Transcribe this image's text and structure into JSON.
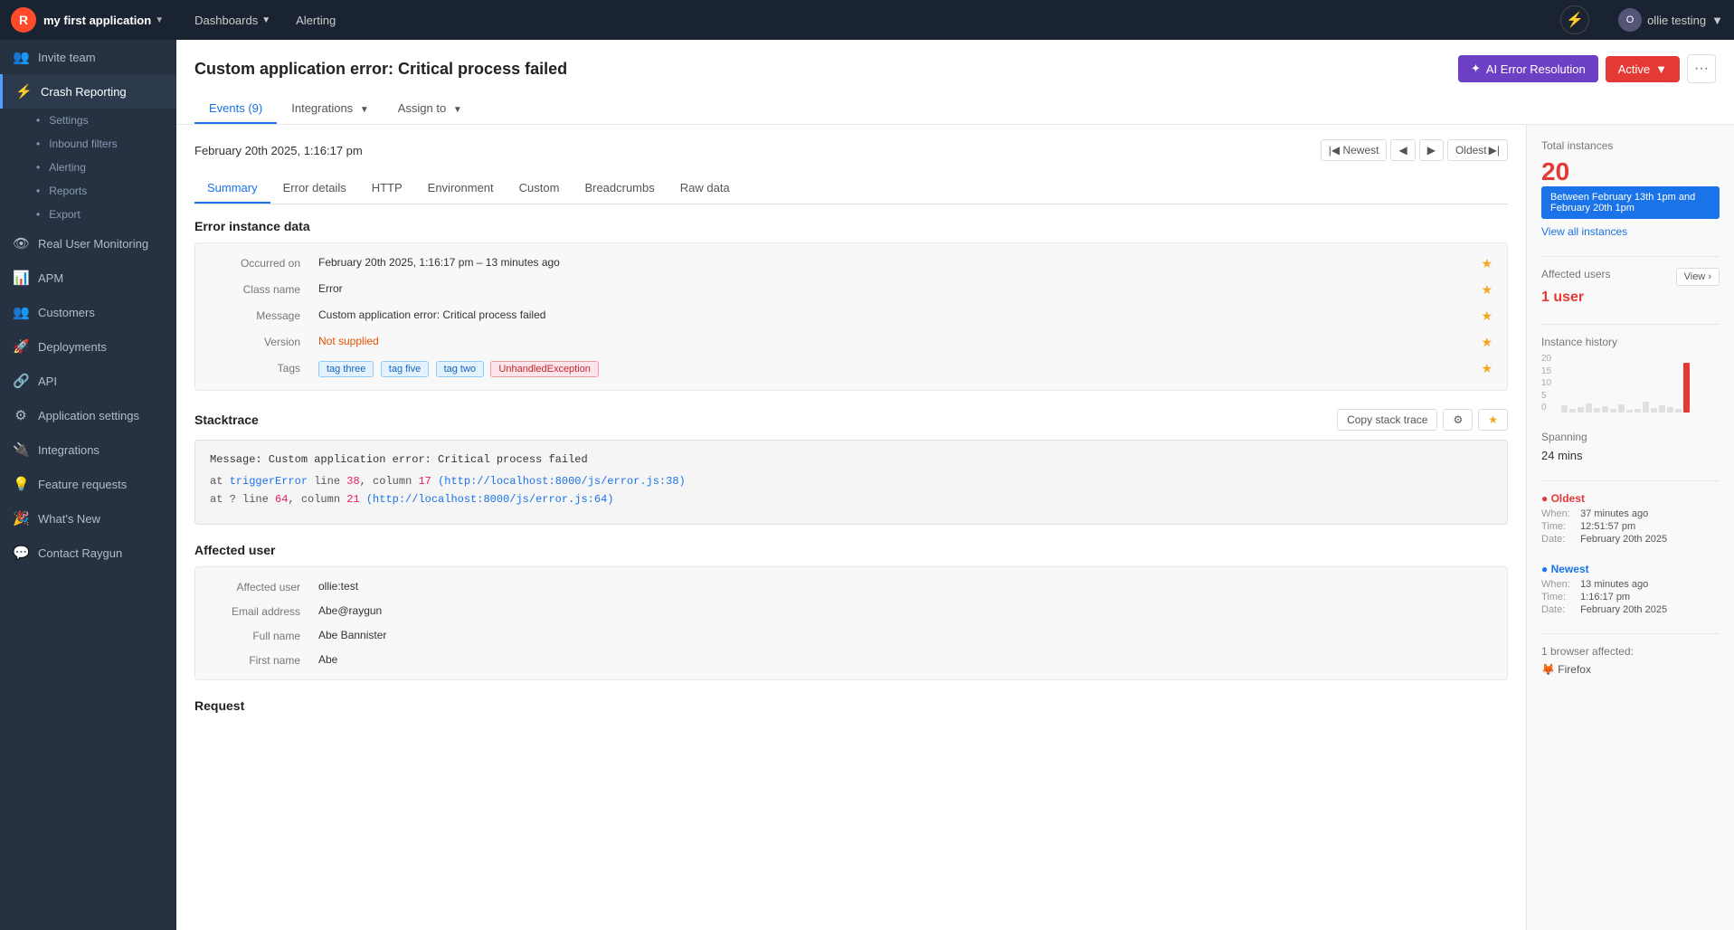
{
  "topnav": {
    "logo": "R",
    "app_name": "my first application",
    "nav_links": [
      {
        "label": "Dashboards",
        "has_dropdown": true
      },
      {
        "label": "Alerting",
        "has_dropdown": false
      }
    ],
    "user": "ollie testing"
  },
  "sidebar": {
    "invite_team": "Invite team",
    "main_items": [
      {
        "id": "crash-reporting",
        "label": "Crash Reporting",
        "icon": "⚡",
        "active": true
      },
      {
        "id": "rum",
        "label": "Real User Monitoring",
        "icon": "👁"
      },
      {
        "id": "apm",
        "label": "APM",
        "icon": "📊"
      },
      {
        "id": "customers",
        "label": "Customers",
        "icon": "👥"
      },
      {
        "id": "deployments",
        "label": "Deployments",
        "icon": "🚀"
      },
      {
        "id": "api",
        "label": "API",
        "icon": "🔗"
      },
      {
        "id": "app-settings",
        "label": "Application settings",
        "icon": "⚙"
      },
      {
        "id": "integrations",
        "label": "Integrations",
        "icon": "🔌"
      },
      {
        "id": "feature-requests",
        "label": "Feature requests",
        "icon": "💡"
      },
      {
        "id": "whats-new",
        "label": "What's New",
        "icon": "🎉"
      },
      {
        "id": "contact",
        "label": "Contact Raygun",
        "icon": "💬"
      }
    ],
    "sub_items": [
      {
        "label": "Settings"
      },
      {
        "label": "Inbound filters"
      },
      {
        "label": "Alerting"
      },
      {
        "label": "Reports"
      },
      {
        "label": "Export"
      }
    ]
  },
  "page": {
    "title": "Custom application error: Critical process failed",
    "ai_btn": "AI Error Resolution",
    "active_btn": "Active",
    "tabs": [
      {
        "label": "Events (9)",
        "active": true
      },
      {
        "label": "Integrations"
      },
      {
        "label": "Assign to"
      }
    ]
  },
  "content": {
    "nav_date": "February 20th 2025, 1:16:17 pm",
    "nav_oldest": "Oldest",
    "tabs": [
      {
        "label": "Summary",
        "active": true
      },
      {
        "label": "Error details"
      },
      {
        "label": "HTTP"
      },
      {
        "label": "Environment"
      },
      {
        "label": "Custom"
      },
      {
        "label": "Breadcrumbs"
      },
      {
        "label": "Raw data"
      }
    ],
    "error_section_title": "Error instance data",
    "error_rows": [
      {
        "label": "Occurred on",
        "value": "February 20th 2025, 1:16:17 pm – 13 minutes ago"
      },
      {
        "label": "Class name",
        "value": "Error"
      },
      {
        "label": "Message",
        "value": "Custom application error: Critical process failed"
      },
      {
        "label": "Version",
        "value": "Not supplied",
        "is_link": true
      },
      {
        "label": "Tags",
        "value": "tags",
        "tags": [
          "tag three",
          "tag five",
          "tag two",
          "UnhandledException"
        ]
      }
    ],
    "stacktrace": {
      "title": "Stacktrace",
      "copy_btn": "Copy stack trace",
      "message": "Message: Custom application error: Critical process failed",
      "lines": [
        {
          "prefix": "at ",
          "func": "triggerError",
          "middle": " line ",
          "line_num": "38",
          "col_prefix": ", column ",
          "col_num": "17",
          "url_text": " (http://localhost:8000/js/error.js:38)"
        },
        {
          "prefix": "at ? line ",
          "func": "",
          "middle": "",
          "line_num": "64",
          "col_prefix": ", column ",
          "col_num": "21",
          "url_text": " (http://localhost:8000/js/error.js:64)"
        }
      ]
    },
    "affected_user": {
      "title": "Affected user",
      "rows": [
        {
          "label": "Affected user",
          "value": "ollie:test"
        },
        {
          "label": "Email address",
          "value": "Abe@raygun"
        },
        {
          "label": "Full name",
          "value": "Abe Bannister"
        },
        {
          "label": "First name",
          "value": "Abe"
        }
      ]
    },
    "request_title": "Request"
  },
  "right_panel": {
    "total_label": "Total instances",
    "total_count": "20",
    "date_range": "Between February 13th 1pm and February 20th 1pm",
    "view_all": "View all instances",
    "affected_users_label": "Affected users",
    "affected_users_count": "1 user",
    "view_btn": "View",
    "instance_history_label": "Instance history",
    "chart_labels": [
      "20",
      "15",
      "10",
      "5",
      "0"
    ],
    "spanning_label": "Spanning",
    "spanning_value": "24 mins",
    "oldest_label": "Oldest",
    "oldest_when_label": "When:",
    "oldest_when": "37 minutes ago",
    "oldest_time_label": "Time:",
    "oldest_time": "12:51:57 pm",
    "oldest_date_label": "Date:",
    "oldest_date": "February 20th 2025",
    "newest_label": "Newest",
    "newest_when_label": "When:",
    "newest_when": "13 minutes ago",
    "newest_time_label": "Time:",
    "newest_time": "1:16:17 pm",
    "newest_date_label": "Date:",
    "newest_date": "February 20th 2025",
    "browser_label": "1 browser affected:",
    "browser_name": "Firefox"
  }
}
